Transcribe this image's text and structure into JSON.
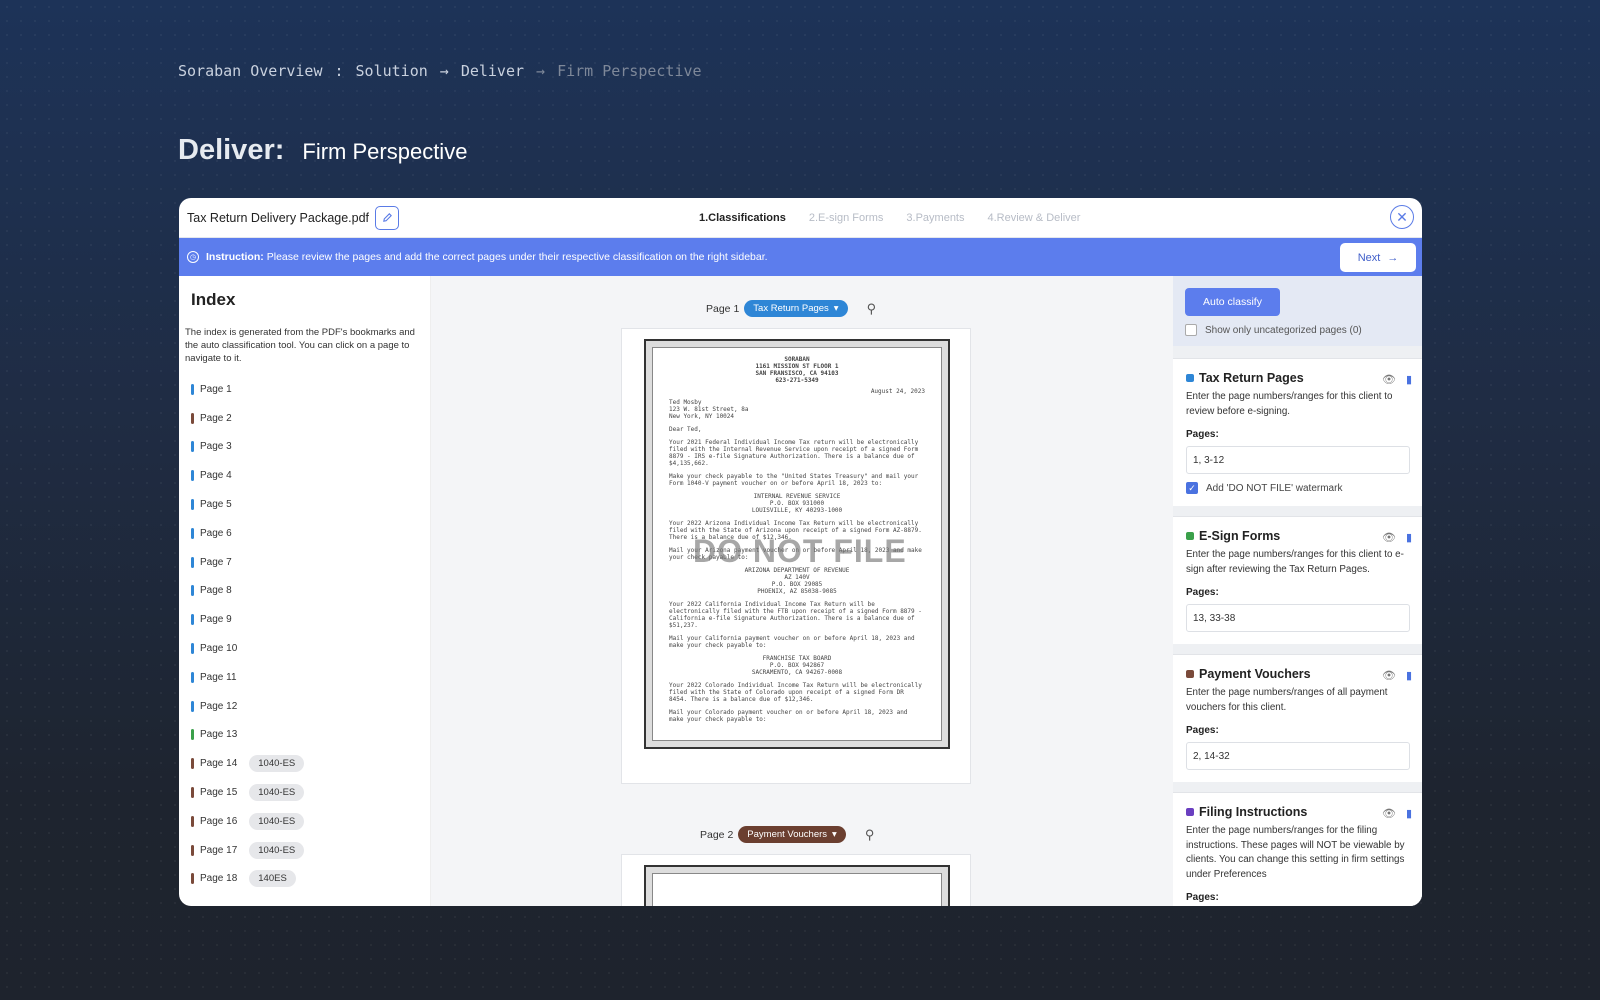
{
  "breadcrumb": {
    "items": [
      "Soraban Overview",
      ":",
      "Solution",
      "→",
      "Deliver",
      "→",
      "Firm Perspective"
    ]
  },
  "heading": {
    "bold": "Deliver:",
    "light": "Firm Perspective"
  },
  "window": {
    "filename": "Tax Return Delivery Package.pdf",
    "steps": [
      "1.Classifications",
      "2.E-sign Forms",
      "3.Payments",
      "4.Review & Deliver"
    ],
    "instruction_label": "Instruction:",
    "instruction_text": "Please review the pages and add the correct pages under their respective classification on the right sidebar.",
    "next_label": "Next"
  },
  "index": {
    "title": "Index",
    "description": "The index is generated from the PDF's bookmarks and the auto classification tool. You can click on a page to navigate to it.",
    "pages": [
      {
        "label": "Page 1",
        "color": "#2e86d6",
        "tag": ""
      },
      {
        "label": "Page 2",
        "color": "#7a4a3a",
        "tag": ""
      },
      {
        "label": "Page 3",
        "color": "#2e86d6",
        "tag": ""
      },
      {
        "label": "Page 4",
        "color": "#2e86d6",
        "tag": ""
      },
      {
        "label": "Page 5",
        "color": "#2e86d6",
        "tag": ""
      },
      {
        "label": "Page 6",
        "color": "#2e86d6",
        "tag": ""
      },
      {
        "label": "Page 7",
        "color": "#2e86d6",
        "tag": ""
      },
      {
        "label": "Page 8",
        "color": "#2e86d6",
        "tag": ""
      },
      {
        "label": "Page 9",
        "color": "#2e86d6",
        "tag": ""
      },
      {
        "label": "Page 10",
        "color": "#2e86d6",
        "tag": ""
      },
      {
        "label": "Page 11",
        "color": "#2e86d6",
        "tag": ""
      },
      {
        "label": "Page 12",
        "color": "#2e86d6",
        "tag": ""
      },
      {
        "label": "Page 13",
        "color": "#3aa04a",
        "tag": ""
      },
      {
        "label": "Page 14",
        "color": "#7a4a3a",
        "tag": "1040-ES"
      },
      {
        "label": "Page 15",
        "color": "#7a4a3a",
        "tag": "1040-ES"
      },
      {
        "label": "Page 16",
        "color": "#7a4a3a",
        "tag": "1040-ES"
      },
      {
        "label": "Page 17",
        "color": "#7a4a3a",
        "tag": "1040-ES"
      },
      {
        "label": "Page 18",
        "color": "#7a4a3a",
        "tag": "140ES"
      }
    ]
  },
  "viewer": {
    "page1": {
      "label": "Page 1",
      "classification": "Tax Return Pages",
      "color": "#2e86d6"
    },
    "page2": {
      "label": "Page 2",
      "classification": "Payment Vouchers",
      "color": "#6b3f30"
    },
    "watermark": "DO NOT FILE",
    "letter": {
      "header": [
        "SORABAN",
        "1161 MISSION ST FLOOR 1",
        "SAN FRANSISCO, CA 94103",
        "623-271-5349"
      ],
      "date": "August 24, 2023",
      "address": [
        "Ted Mosby",
        "123 W. 81st Street, 8a",
        "New York, NY 10024"
      ],
      "greeting": "Dear Ted,",
      "p1": "Your 2021 Federal Individual Income Tax return will be electronically filed with the Internal Revenue Service upon receipt of a signed Form 8879 - IRS e-file Signature Authorization. There is a balance due of $4,135,662.",
      "p2": "Make your check payable to the \"United States Treasury\" and mail your Form 1040-V payment voucher on or before April 18, 2023 to:",
      "irs": [
        "INTERNAL REVENUE SERVICE",
        "P.O. BOX 931000",
        "LOUISVILLE, KY 40293-1000"
      ],
      "p3": "Your 2022 Arizona Individual Income Tax Return will be electronically filed with the State of Arizona upon receipt of a signed Form AZ-8879. There is a balance due of $12,346.",
      "p4": "Mail your Arizona payment voucher on or before April 18, 2023 and make your check payable to:",
      "az": [
        "ARIZONA DEPARTMENT OF REVENUE",
        "AZ 140V",
        "P.O. BOX 29085",
        "PHOENIX, AZ 85038-9085"
      ],
      "p5": "Your 2022 California Individual Income Tax Return will be electronically filed with the FTB upon receipt of a signed Form 8879 - California e-file Signature Authorization. There is a balance due of $51,237.",
      "p6": "Mail your California payment voucher on or before April 18, 2023 and make your check payable to:",
      "ca": [
        "FRANCHISE TAX BOARD",
        "P.O. BOX 942867",
        "SACRAMENTO, CA 94267-0008"
      ],
      "p7": "Your 2022 Colorado Individual Income Tax Return will be electronically filed with the State of Colorado upon receipt of a signed Form DR 8454. There is a balance due of $12,346.",
      "p8": "Mail your Colorado payment voucher on or before April 18, 2023 and make your check payable to:"
    }
  },
  "sidebar": {
    "auto_classify": "Auto classify",
    "show_uncategorized": "Show only uncategorized pages (0)",
    "sections": [
      {
        "title": "Tax Return Pages",
        "color": "#2e86d6",
        "desc": "Enter the page numbers/ranges for this client to review before e-signing.",
        "pages_label": "Pages:",
        "pages": "1, 3-12",
        "watermark_opt": "Add 'DO NOT FILE' watermark"
      },
      {
        "title": "E-Sign Forms",
        "color": "#3aa04a",
        "desc": "Enter the page numbers/ranges for this client to e-sign after reviewing the Tax Return Pages.",
        "pages_label": "Pages:",
        "pages": "13, 33-38"
      },
      {
        "title": "Payment Vouchers",
        "color": "#7a4a3a",
        "desc": "Enter the page numbers/ranges of all payment vouchers for this client.",
        "pages_label": "Pages:",
        "pages": "2, 14-32"
      },
      {
        "title": "Filing Instructions",
        "color": "#6a3fc0",
        "desc": "Enter the page numbers/ranges for the filing instructions. These pages will NOT be viewable by clients. You can change this setting in firm settings under Preferences",
        "pages_label": "Pages:"
      }
    ]
  }
}
